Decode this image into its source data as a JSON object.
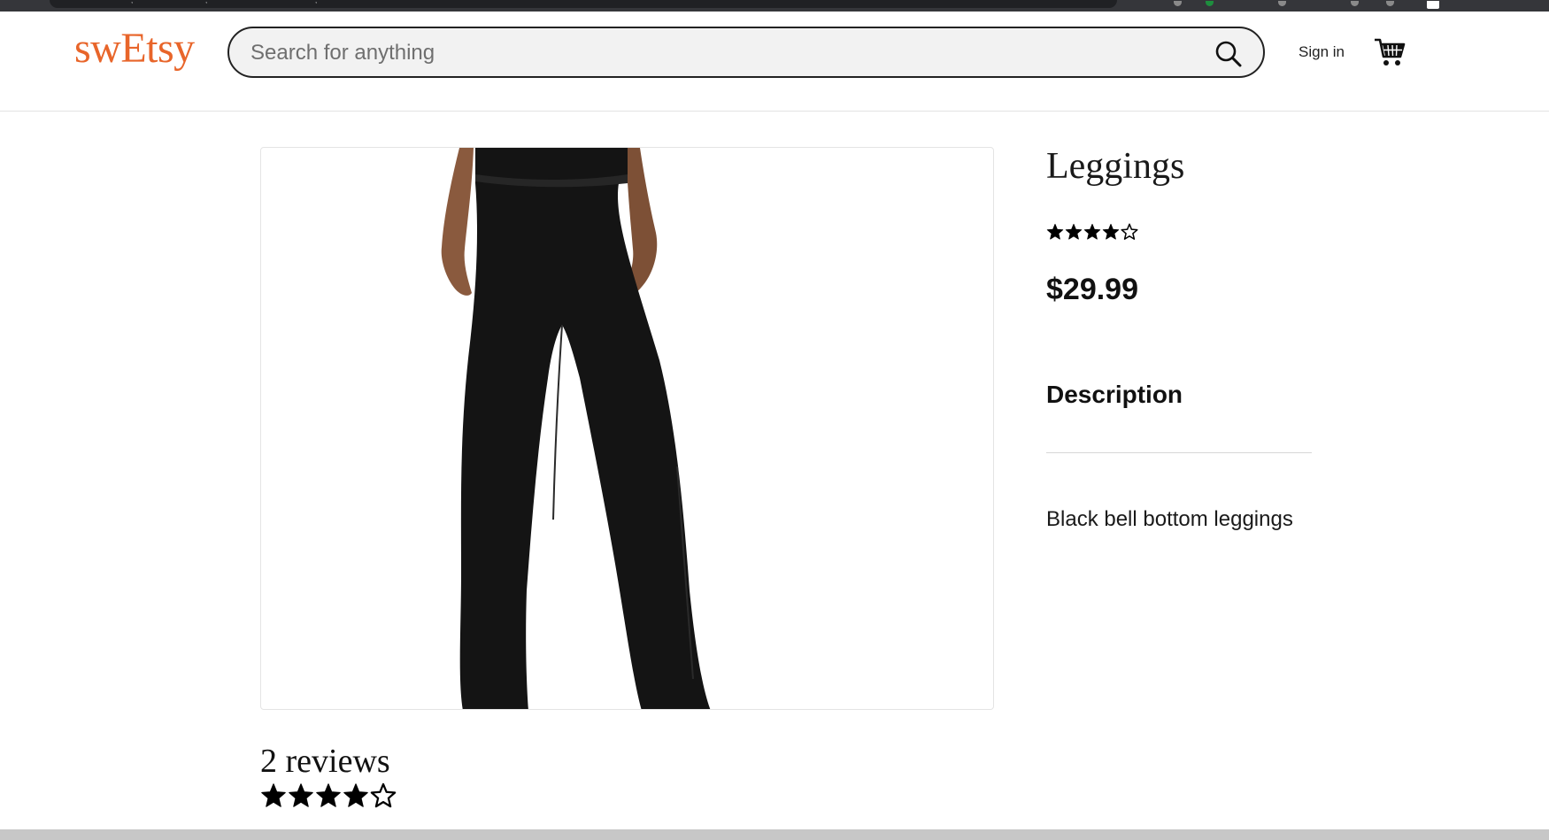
{
  "brand": {
    "name": "swEtsy",
    "color": "#e8652a"
  },
  "search": {
    "placeholder": "Search for anything",
    "value": ""
  },
  "nav": {
    "signin_label": "Sign in"
  },
  "icons": {
    "search": "search-icon",
    "cart": "cart-icon"
  },
  "product": {
    "title": "Leggings",
    "rating": 4,
    "rating_max": 5,
    "price": "$29.99",
    "description_heading": "Description",
    "description": "Black bell bottom leggings",
    "image_alt": "Black bell bottom leggings worn by model"
  },
  "reviews": {
    "count_label": "2 reviews",
    "rating": 4,
    "rating_max": 5
  }
}
